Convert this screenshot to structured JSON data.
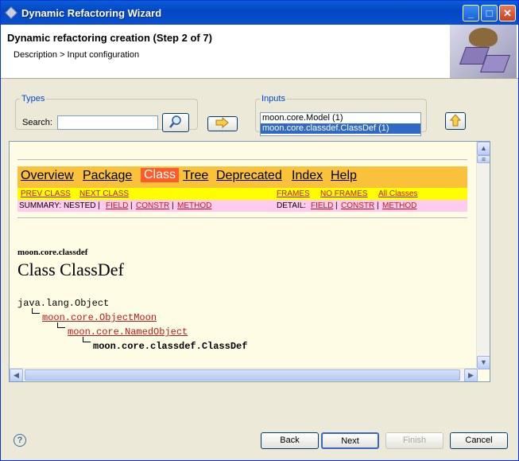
{
  "window": {
    "title": "Dynamic Refactoring Wizard",
    "minimize": "_",
    "maximize": "□",
    "close": "✕"
  },
  "header": {
    "title": "Dynamic refactoring creation (Step 2 of 7)",
    "subtitle": "Description > Input configuration"
  },
  "types": {
    "legend": "Types",
    "search_label": "Search:",
    "search_value": "",
    "search_icon": "magnifier-icon"
  },
  "add_arrow_icon": "right-arrow-icon",
  "inputs": {
    "legend": "Inputs",
    "items": [
      "moon.core.Model (1)",
      "moon.core.classdef.ClassDef (1)"
    ],
    "selected_index": 1,
    "up_icon": "up-arrow-icon"
  },
  "javadoc": {
    "nav": [
      "Overview",
      "Package",
      "Class",
      "Tree",
      "Deprecated",
      "Index",
      "Help"
    ],
    "active_nav": "Class",
    "prev_class": "PREV CLASS",
    "next_class": "NEXT CLASS",
    "frames": "FRAMES",
    "no_frames": "NO FRAMES",
    "all_classes": "All Classes",
    "summary_label": "SUMMARY: NESTED |",
    "summary_field": "FIELD",
    "summary_constr": "CONSTR",
    "summary_method": "METHOD",
    "detail_label": "DETAIL:",
    "detail_field": "FIELD",
    "detail_constr": "CONSTR",
    "detail_method": "METHOD",
    "sep": "|",
    "package": "moon.core.classdef",
    "class_title": "Class ClassDef",
    "hierarchy": [
      "java.lang.Object",
      "moon.core.ObjectMoon",
      "moon.core.NamedObject",
      "moon.core.classdef.ClassDef"
    ]
  },
  "buttons": {
    "back": "Back",
    "next": "Next",
    "finish": "Finish",
    "cancel": "Cancel",
    "help": "?"
  }
}
